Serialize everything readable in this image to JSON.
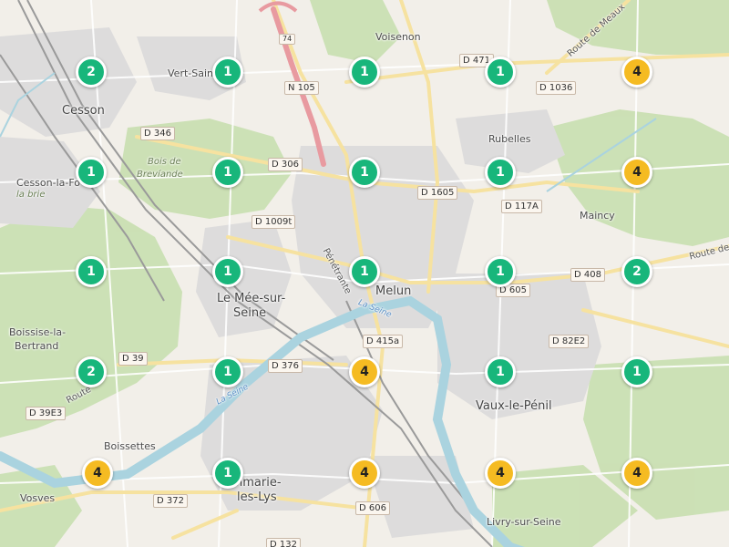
{
  "colors": {
    "cluster_single_and_pair": "#18b67b",
    "cluster_four": "#f5bb22",
    "land": "#f2efe9",
    "forest": "#c8dfb0",
    "water": "#aad3df",
    "urban": "#e0dfdf"
  },
  "places": {
    "voisenon": "Voisenon",
    "vert_saint": "Vert-Sain",
    "cesson": "Cesson",
    "rubelles": "Rubelles",
    "cesson_la_foret": "Cesson-la-Fo",
    "la_brie": "la brie",
    "bois_de_breviande_1": "Bois de",
    "bois_de_breviande_2": "Brevíande",
    "maincy": "Maincy",
    "le_mee_1": "Le Mée-sur-",
    "le_mee_2": "Seine",
    "melun": "Melun",
    "boissise_1": "Boissise-la-",
    "boissise_2": "Bertrand",
    "vaux_le_penil": "Vaux-le-Pénil",
    "boissettes": "Boissettes",
    "vosves": "Vosves",
    "dammarie_1": "nmarie-",
    "dammarie_2": "les-Lys",
    "livry": "Livry-sur-Seine",
    "la_seine_1": "La Seine",
    "la_seine_2": "La Seine",
    "route_de_meaux": "Route de Meaux",
    "route_de_n": "Route de N",
    "route_left": "Route",
    "penetrante": "Pénétrante"
  },
  "road_shields": {
    "n105": "N 105",
    "d471": "D 471",
    "d1036": "D 1036",
    "d346": "D 346",
    "d306": "D 306",
    "d1605": "D 1605",
    "d117a": "D 117A",
    "d1009t": "D 1009t",
    "d408": "D 408",
    "d605": "D 605",
    "d82e2": "D 82E2",
    "d415a": "D 415a",
    "d39": "D 39",
    "d376": "D 376",
    "d39e3": "D 39E3",
    "d372": "D 372",
    "d606": "D 606",
    "d132": "D 132",
    "a5": "74"
  },
  "clusters": [
    {
      "count": "2",
      "color": "green"
    },
    {
      "count": "1",
      "color": "green"
    },
    {
      "count": "1",
      "color": "green"
    },
    {
      "count": "1",
      "color": "green"
    },
    {
      "count": "4",
      "color": "yellow"
    },
    {
      "count": "1",
      "color": "green"
    },
    {
      "count": "1",
      "color": "green"
    },
    {
      "count": "1",
      "color": "green"
    },
    {
      "count": "1",
      "color": "green"
    },
    {
      "count": "4",
      "color": "yellow"
    },
    {
      "count": "1",
      "color": "green"
    },
    {
      "count": "1",
      "color": "green"
    },
    {
      "count": "1",
      "color": "green"
    },
    {
      "count": "1",
      "color": "green"
    },
    {
      "count": "2",
      "color": "green"
    },
    {
      "count": "2",
      "color": "green"
    },
    {
      "count": "1",
      "color": "green"
    },
    {
      "count": "4",
      "color": "yellow"
    },
    {
      "count": "1",
      "color": "green"
    },
    {
      "count": "1",
      "color": "green"
    },
    {
      "count": "4",
      "color": "yellow"
    },
    {
      "count": "1",
      "color": "green"
    },
    {
      "count": "4",
      "color": "yellow"
    },
    {
      "count": "4",
      "color": "yellow"
    },
    {
      "count": "4",
      "color": "yellow"
    }
  ]
}
